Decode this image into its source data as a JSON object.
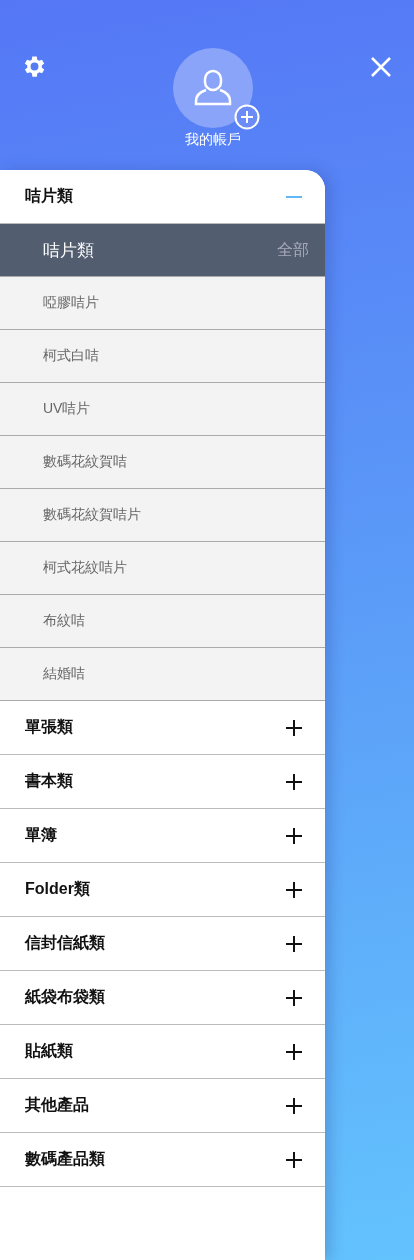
{
  "header": {
    "account_label": "我的帳戶"
  },
  "categories": [
    {
      "label": "咭片類",
      "expanded": true,
      "subheader": {
        "label": "咭片類",
        "all_label": "全部"
      },
      "children": [
        "啞膠咭片",
        "柯式白咭",
        "UV咭片",
        "數碼花紋賀咭",
        "數碼花紋賀咭片",
        "柯式花紋咭片",
        "布紋咭",
        "結婚咭"
      ]
    },
    {
      "label": "單張類",
      "expanded": false
    },
    {
      "label": "書本類",
      "expanded": false
    },
    {
      "label": "單簿",
      "expanded": false
    },
    {
      "label": "Folder類",
      "expanded": false
    },
    {
      "label": "信封信紙類",
      "expanded": false
    },
    {
      "label": "紙袋布袋類",
      "expanded": false
    },
    {
      "label": "貼紙類",
      "expanded": false
    },
    {
      "label": "其他產品",
      "expanded": false
    },
    {
      "label": "數碼產品類",
      "expanded": false
    }
  ]
}
